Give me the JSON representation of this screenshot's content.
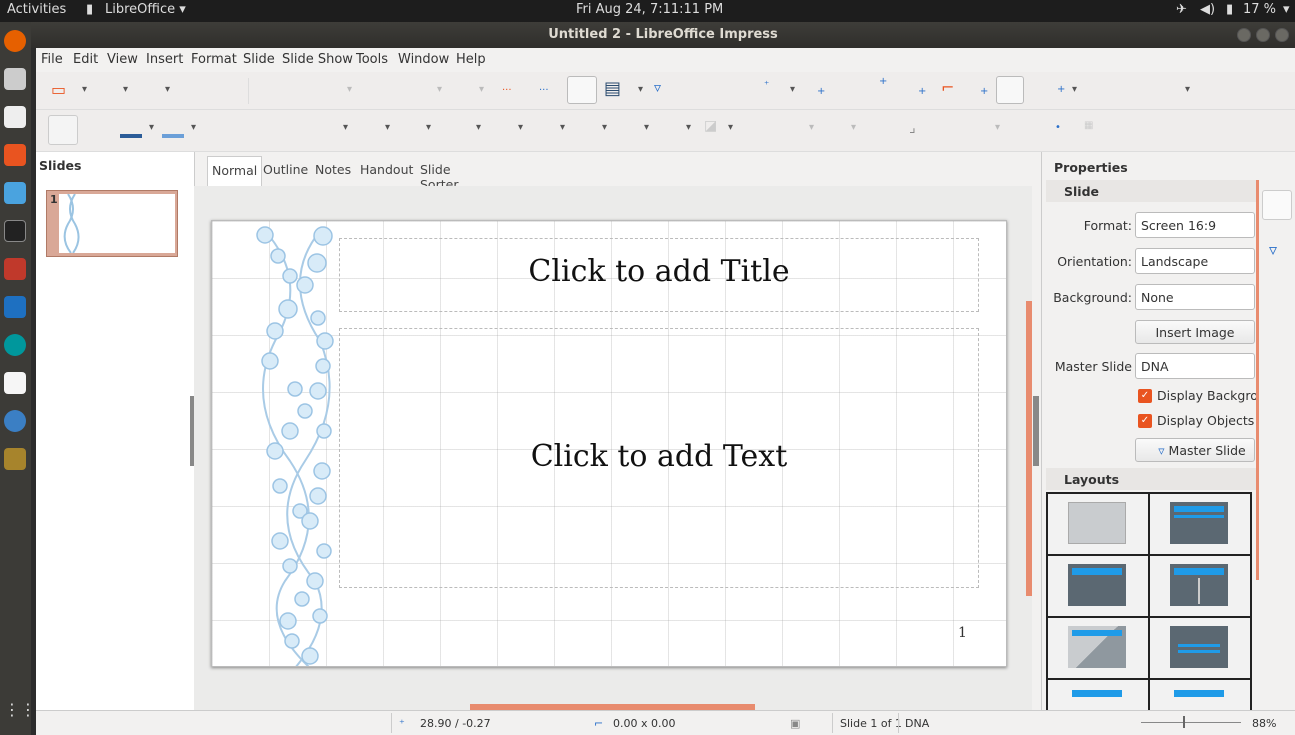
{
  "system_bar": {
    "activities": "Activities",
    "app_menu": "LibreOffice",
    "clock": "Fri Aug 24,  7:11:11 PM",
    "battery": "17 %"
  },
  "window": {
    "title": "Untitled 2 - LibreOffice Impress"
  },
  "menubar": {
    "items": [
      "File",
      "Edit",
      "View",
      "Insert",
      "Format",
      "Slide",
      "Slide Show",
      "Tools",
      "Window",
      "Help"
    ]
  },
  "slides_panel": {
    "header": "Slides",
    "thumb_number": "1"
  },
  "view_tabs": [
    "Normal",
    "Outline",
    "Notes",
    "Handout",
    "Slide Sorter"
  ],
  "slide": {
    "title_placeholder": "Click to add Title",
    "text_placeholder": "Click to add Text",
    "page_number": "1"
  },
  "properties": {
    "header": "Properties",
    "section_slide": "Slide",
    "format_label": "Format:",
    "format_value": "Screen 16:9",
    "orientation_label": "Orientation:",
    "orientation_value": "Landscape",
    "background_label": "Background:",
    "background_value": "None",
    "insert_image": "Insert Image",
    "master_slide_label": "Master Slide",
    "master_slide_value": "DNA",
    "display_background": "Display Backgrou",
    "display_objects": "Display Objects",
    "master_slide_button": "Master Slide",
    "section_layouts": "Layouts"
  },
  "statusbar": {
    "position": "28.90 / -0.27",
    "size": "0.00 x 0.00",
    "slide_count": "Slide 1 of 1",
    "master": "DNA",
    "zoom": "88%"
  },
  "colors": {
    "accent": "#e95420",
    "scroll": "#e88b6e",
    "dock": "#3c3b37"
  }
}
